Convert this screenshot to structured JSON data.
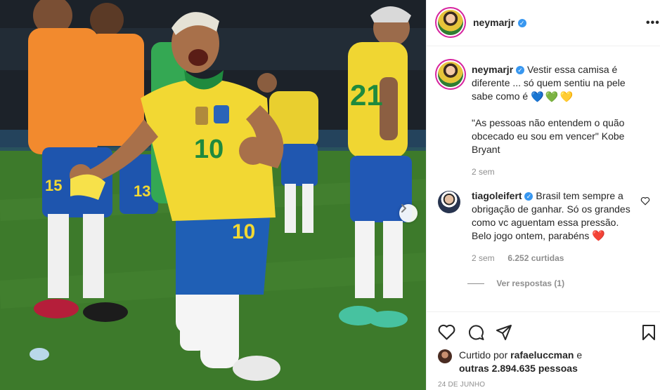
{
  "post": {
    "photo": {
      "jersey_number": "10",
      "shorts_number": "10",
      "player_number_13": "13",
      "player_number_15": "15",
      "player_number_21": "21"
    },
    "header": {
      "username": "neymarjr",
      "verified_glyph": "✓",
      "more_icon": "more-options-icon"
    },
    "caption": {
      "username": "neymarjr",
      "text": "Vestir essa camisa é diferente ... só quem sentiu na pele sabe como é",
      "hearts": [
        "💙",
        "💚",
        "💛"
      ],
      "quote": "\"As pessoas não entendem o quão obcecado eu sou em vencer\" Kobe Bryant",
      "time": "2 sem"
    },
    "comment": {
      "username": "tiagoleifert",
      "text": "Brasil tem sempre a obrigação de ganhar. Só os grandes como vc aguentam essa pressão. Belo jogo ontem, parabéns",
      "heart": "❤️",
      "time": "2 sem",
      "likes": "6.252 curtidas",
      "view_replies": "Ver respostas (1)"
    },
    "liked_by": {
      "prefix": "Curtido por",
      "user": "rafaeluccman",
      "conjunction": "e",
      "others": "outras 2.894.635 pessoas"
    },
    "date": "24 DE JUNHO",
    "colors": {
      "verified_blue": "#3897f0",
      "secondary_text": "#8e8e8e",
      "jersey_yellow": "#f2d833",
      "shorts_blue": "#1f5fb5",
      "pitch_green": "#3f7a2c"
    }
  }
}
